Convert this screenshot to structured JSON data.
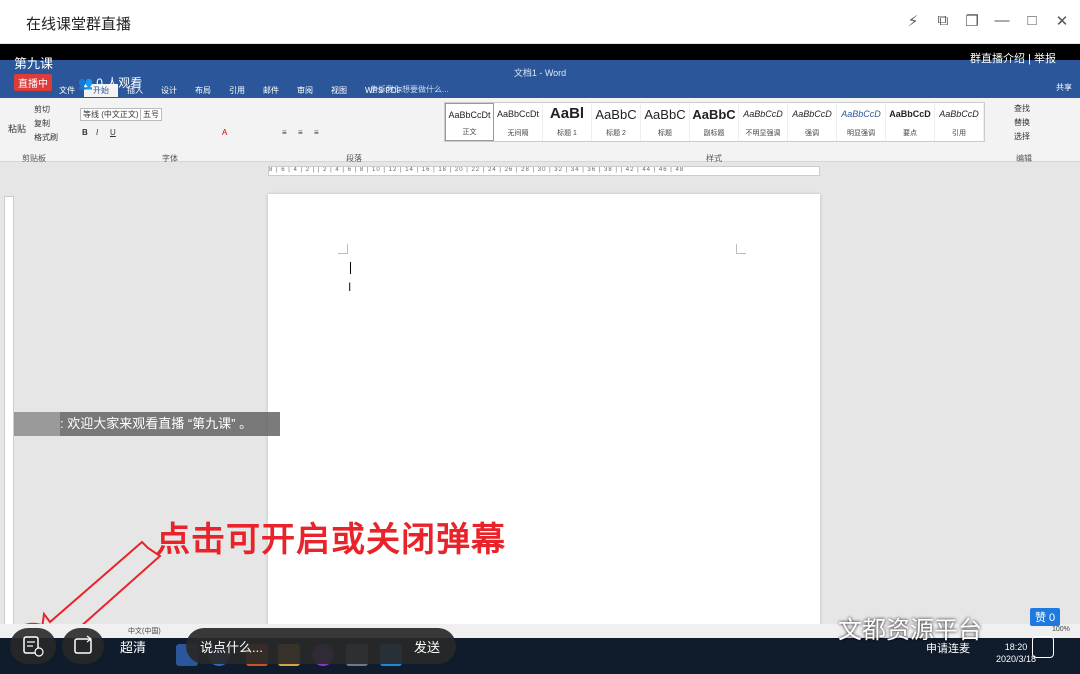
{
  "window": {
    "title": "在线课堂群直播",
    "controls": [
      "⚡",
      "⧉",
      "❐",
      "—",
      "□",
      "✕"
    ]
  },
  "live": {
    "lesson_title": "第九课",
    "status_badge": "直播中",
    "viewers": "0 人观看",
    "intro_link": "群直播介绍",
    "separator": "|",
    "report_link": "举报"
  },
  "word": {
    "doc_title": "文档1 - Word",
    "tabs": [
      "文件",
      "开始",
      "插入",
      "设计",
      "布局",
      "引用",
      "邮件",
      "审阅",
      "视图",
      "WPS PDF"
    ],
    "tell_me": "告诉我你想要做什么...",
    "share": "共享",
    "clipboard": {
      "paste": "粘贴",
      "cut": "剪切",
      "copy": "复制",
      "format_painter": "格式刷",
      "group": "剪贴板"
    },
    "font": {
      "family": "等线 (中文正文)",
      "size": "五号",
      "group": "字体"
    },
    "paragraph_group": "段落",
    "styles_group": "样式",
    "editing": {
      "find": "查找",
      "replace": "替换",
      "select": "选择",
      "group": "编辑"
    },
    "styles": [
      {
        "sample": "AaBbCcDt",
        "name": "正文"
      },
      {
        "sample": "AaBbCcDt",
        "name": "无间隔"
      },
      {
        "sample": "AaBl",
        "name": "标题 1"
      },
      {
        "sample": "AaBbC",
        "name": "标题 2"
      },
      {
        "sample": "AaBbC",
        "name": "标题"
      },
      {
        "sample": "AaBbC",
        "name": "副标题"
      },
      {
        "sample": "AaBbCcD",
        "name": "不明显强调"
      },
      {
        "sample": "AaBbCcD",
        "name": "强调"
      },
      {
        "sample": "AaBbCcD",
        "name": "明显强调"
      },
      {
        "sample": "AaBbCcD",
        "name": "要点"
      },
      {
        "sample": "AaBbCcD",
        "name": "引用"
      }
    ],
    "ruler_top": "8 | 6 | 4 | 2 |   | 2 | 4 | 6 | 8 | 10 | 12 | 14 | 16 | 18 | 20 | 22 | 24 | 26 | 28 | 30 | 32 | 34 | 36 | 38 |   | 42 | 44 | 46 | 48",
    "status_lang": "中文(中国)",
    "zoom": "100%"
  },
  "danmu": {
    "message": ": 欢迎大家来观看直播 “第九课” 。"
  },
  "annotation": "点击可开启或关闭弹幕",
  "controls": {
    "quality": "超清",
    "comment_placeholder": "说点什么...",
    "send": "发送",
    "request_mic": "申请连麦",
    "likes": "赞 0"
  },
  "taskbar": {
    "time": "18:20",
    "date": "2020/3/18"
  },
  "watermark": "文都资源平台",
  "colors": {
    "word_blue": "#2b579a",
    "annotation_red": "#e8232a",
    "live_red": "#e03b3b"
  }
}
